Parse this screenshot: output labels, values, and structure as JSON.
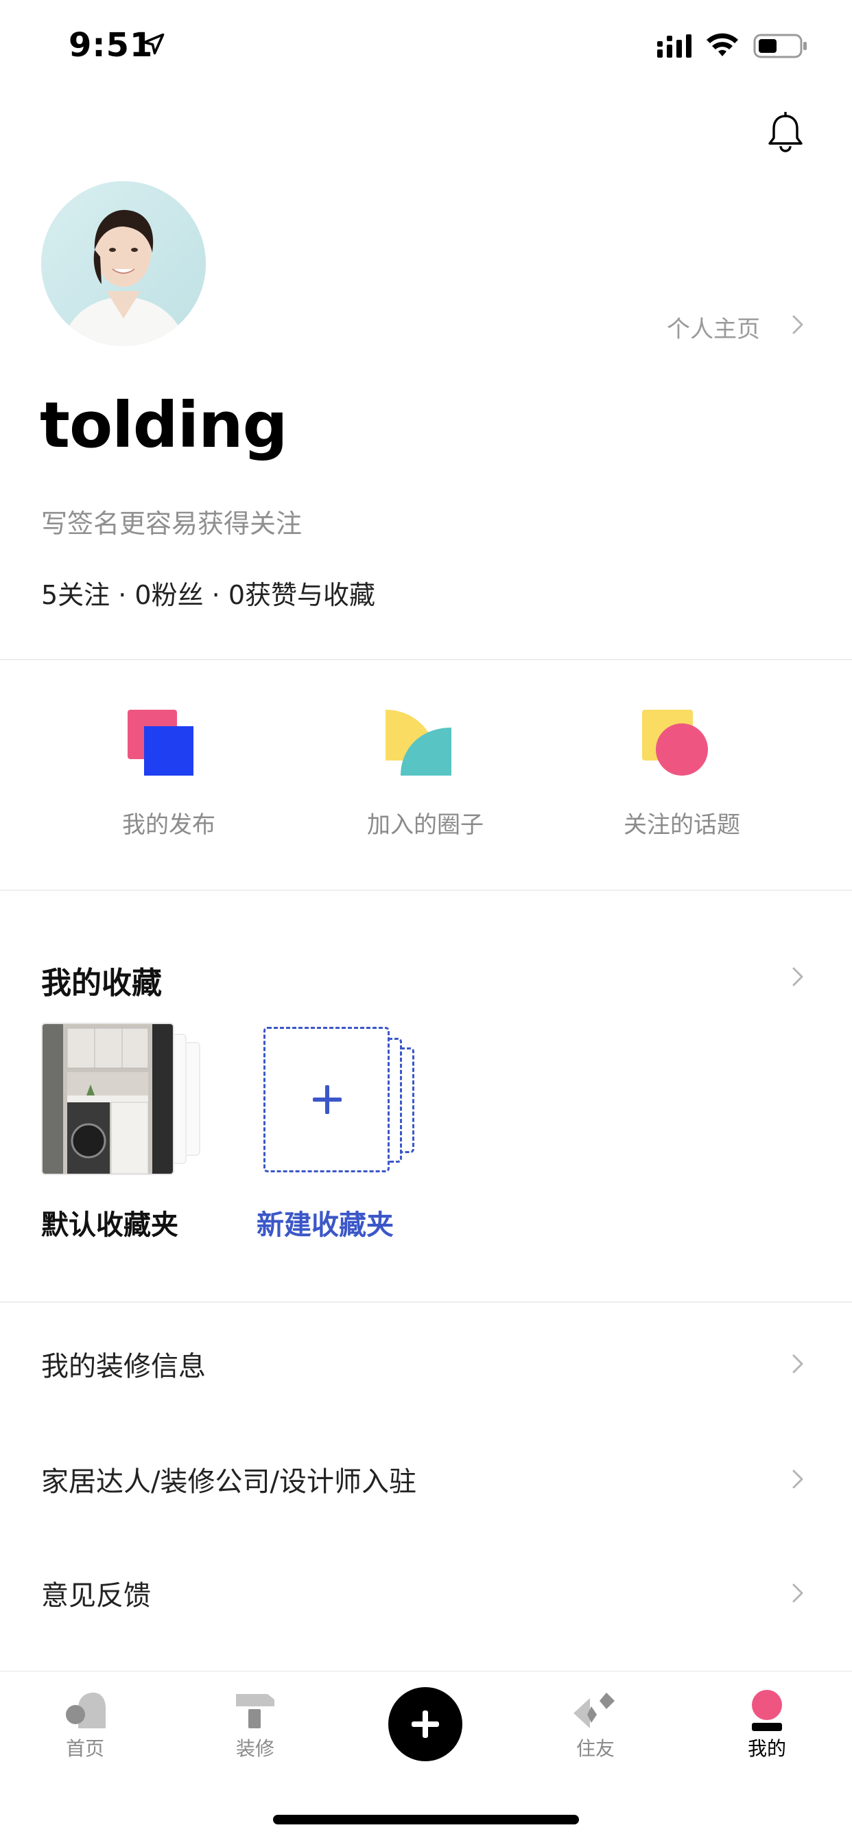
{
  "status_bar": {
    "time": "9:51"
  },
  "profile": {
    "home_link": "个人主页",
    "username": "tolding",
    "signature": "写签名更容易获得关注",
    "stats": "5关注 · 0粉丝 · 0获赞与收藏"
  },
  "quick_actions": [
    {
      "label": "我的发布",
      "icon": "posts-icon"
    },
    {
      "label": "加入的圈子",
      "icon": "circles-icon"
    },
    {
      "label": "关注的话题",
      "icon": "topics-icon"
    }
  ],
  "favorites": {
    "title": "我的收藏",
    "default_folder": "默认收藏夹",
    "new_folder": "新建收藏夹"
  },
  "menu": [
    {
      "label": "我的装修信息"
    },
    {
      "label": "家居达人/装修公司/设计师入驻"
    },
    {
      "label": "意见反馈"
    }
  ],
  "tabbar": {
    "items": [
      {
        "label": "首页",
        "icon": "home-icon"
      },
      {
        "label": "装修",
        "icon": "renovation-icon"
      },
      {
        "label": "住友",
        "icon": "friends-icon"
      },
      {
        "label": "我的",
        "icon": "me-icon",
        "active": true
      }
    ]
  },
  "colors": {
    "accent_blue": "#3b57c7",
    "pink": "#ee5681",
    "yellow": "#f9dc61",
    "teal": "#58c4c4",
    "blue": "#1f3ff2"
  }
}
